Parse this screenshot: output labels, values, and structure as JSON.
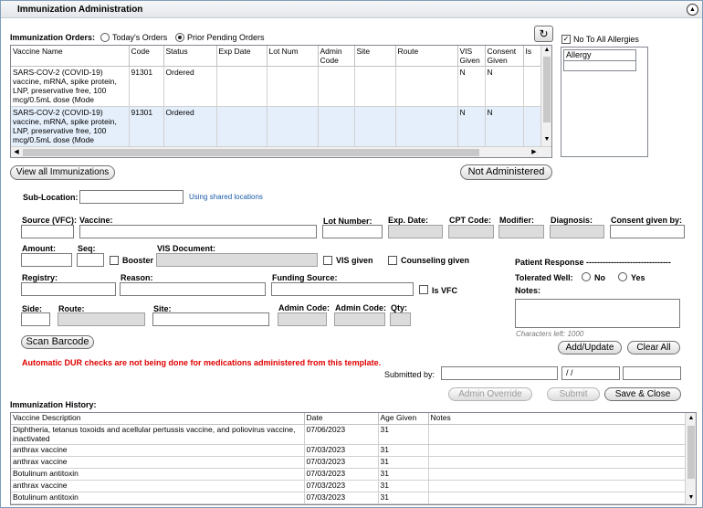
{
  "title": "Immunization Administration",
  "orders": {
    "label": "Immunization Orders:",
    "radio_today": "Today's Orders",
    "radio_prior": "Prior Pending Orders",
    "columns": [
      "Vaccine Name",
      "Code",
      "Status",
      "Exp Date",
      "Lot Num",
      "Admin Code",
      "Site",
      "Route",
      "VIS Given",
      "Consent Given",
      "Is"
    ],
    "rows": [
      {
        "vaccine": "SARS-COV-2 (COVID-19) vaccine, mRNA, spike protein, LNP, preservative free, 100 mcg/0.5mL dose (Mode",
        "code": "91301",
        "status": "Ordered",
        "vis": "N",
        "consent": "N"
      },
      {
        "vaccine": "SARS-COV-2 (COVID-19) vaccine, mRNA, spike protein, LNP, preservative free, 100 mcg/0.5mL dose (Mode",
        "code": "91301",
        "status": "Ordered",
        "vis": "N",
        "consent": "N"
      }
    ]
  },
  "allergy": {
    "no_allergies_label": "No To All Allergies",
    "column": "Allergy"
  },
  "buttons": {
    "view_all": "View all Immunizations",
    "not_administered": "Not Administered",
    "scan_barcode": "Scan Barcode",
    "add_update": "Add/Update",
    "clear_all": "Clear All",
    "admin_override": "Admin Override",
    "submit": "Submit",
    "save_close": "Save & Close"
  },
  "form": {
    "sub_location": "Sub-Location:",
    "shared_locations": "Using shared locations",
    "source_vfc": "Source (VFC):",
    "vaccine": "Vaccine:",
    "lot_number": "Lot Number:",
    "exp_date": "Exp. Date:",
    "cpt_code": "CPT Code:",
    "modifier": "Modifier:",
    "diagnosis": "Diagnosis:",
    "consent_given_by": "Consent given by:",
    "amount": "Amount:",
    "seq": "Seq:",
    "booster": "Booster",
    "vis_document": "VIS Document:",
    "vis_given": "VIS given",
    "counseling_given": "Counseling given",
    "registry": "Registry:",
    "reason": "Reason:",
    "funding_source": "Funding Source:",
    "is_vfc": "Is VFC",
    "side": "Side:",
    "route": "Route:",
    "site": "Site:",
    "admin_code": "Admin Code:",
    "admin_code2": "Admin Code:",
    "qty": "Qty:",
    "patient_response": "Patient Response -------------------------------",
    "tolerated_well": "Tolerated Well:",
    "no": "No",
    "yes": "Yes",
    "notes": "Notes:",
    "chars_left": "Characters left: 1000",
    "dur_warning": "Automatic DUR checks are not being done for medications administered from this template.",
    "submitted_by": "Submitted by:",
    "date_placeholder": " / /"
  },
  "history": {
    "label": "Immunization History:",
    "columns": [
      "Vaccine Description",
      "Date",
      "Age Given",
      "Notes"
    ],
    "rows": [
      {
        "desc": "Diphtheria, tetanus toxoids and acellular pertussis vaccine, and poliovirus vaccine, inactivated",
        "date": "07/06/2023",
        "age": "31"
      },
      {
        "desc": "anthrax vaccine",
        "date": "07/03/2023",
        "age": "31"
      },
      {
        "desc": "anthrax vaccine",
        "date": "07/03/2023",
        "age": "31"
      },
      {
        "desc": "Botulinum antitoxin",
        "date": "07/03/2023",
        "age": "31"
      },
      {
        "desc": "anthrax vaccine",
        "date": "07/03/2023",
        "age": "31"
      },
      {
        "desc": "Botulinum antitoxin",
        "date": "07/03/2023",
        "age": "31"
      }
    ]
  }
}
